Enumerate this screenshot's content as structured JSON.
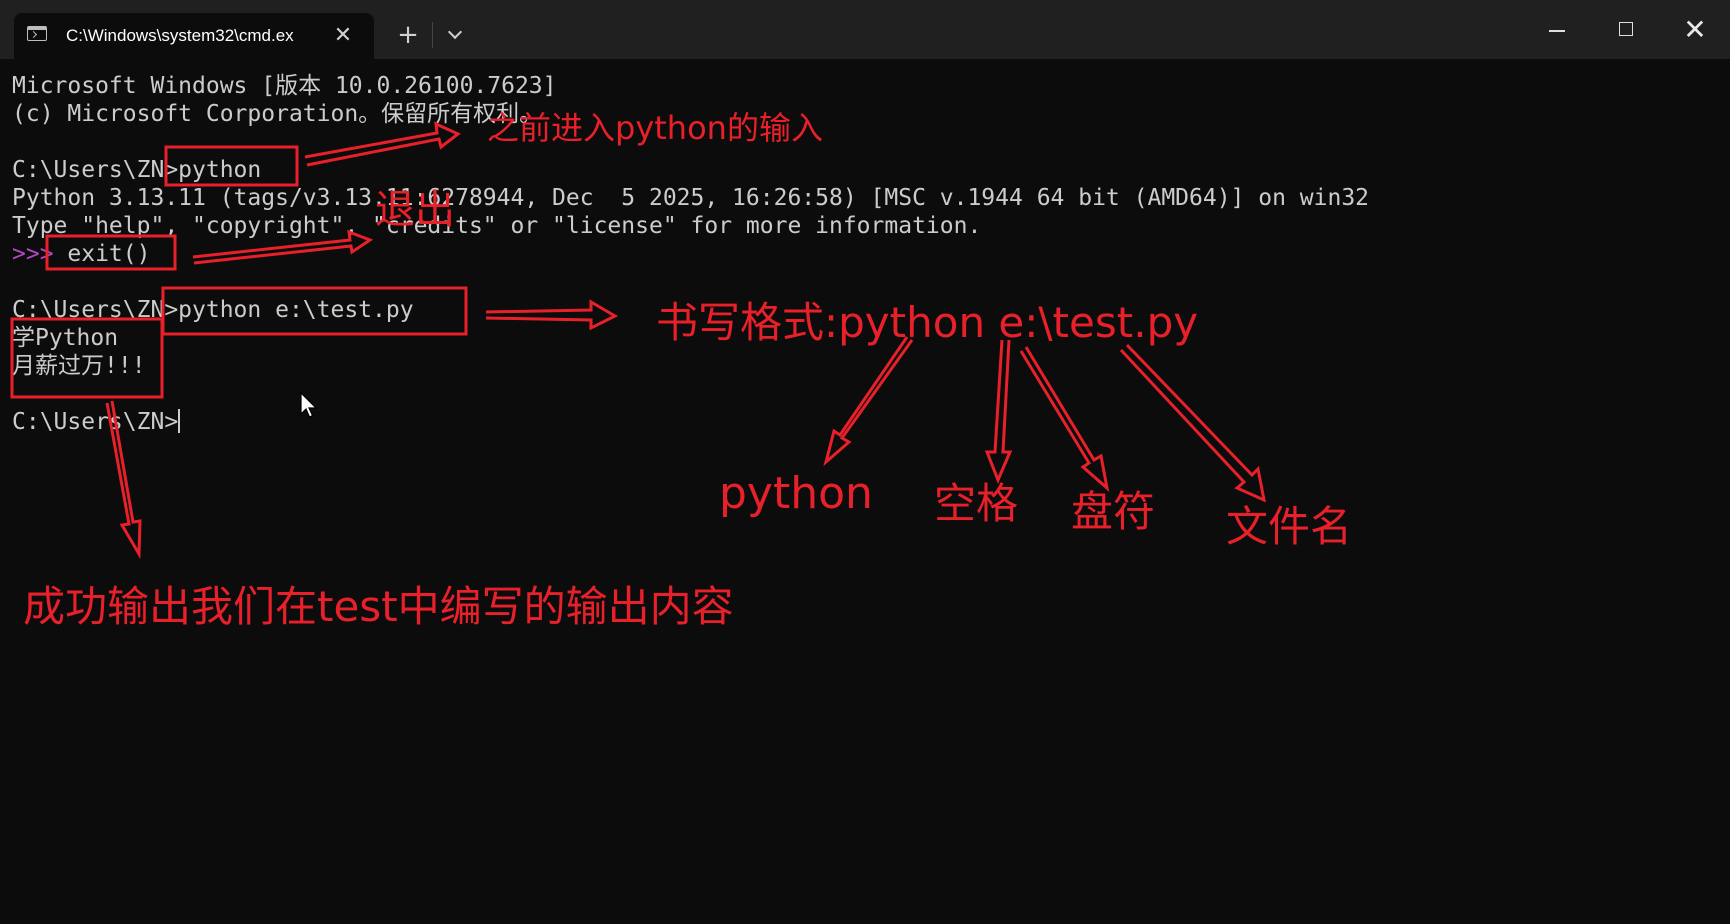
{
  "window": {
    "tab_title": "C:\\Windows\\system32\\cmd.ex",
    "tab_close_glyph": "✕",
    "new_tab_glyph": "+",
    "close_glyph": "✕"
  },
  "console": {
    "lines": [
      "Microsoft Windows [版本 10.0.26100.7623]",
      "(c) Microsoft Corporation。保留所有权利。",
      "",
      "C:\\Users\\ZN>python",
      "Python 3.13.11 (tags/v3.13.11:6278944, Dec  5 2025, 16:26:58) [MSC v.1944 64 bit (AMD64)] on win32",
      "Type \"help\", \"copyright\", \"credits\" or \"license\" for more information.",
      "",
      "",
      "C:\\Users\\ZN>python e:\\test.py",
      "学Python",
      "月薪过万!!!",
      "",
      "C:\\Users\\ZN>"
    ],
    "repl_prompt": ">>>",
    "repl_command": " exit()"
  },
  "annotations": {
    "python_enter": "之前进入python的输入",
    "exit": "退出",
    "format": "书写格式:python e:\\test.py",
    "part_python": "python",
    "part_space": "空格",
    "part_drive": "盘符",
    "part_filename": "文件名",
    "output_success": "成功输出我们在test中编写的输出内容"
  },
  "colors": {
    "annotation": "#e8202a",
    "console_bg": "#0c0c0c",
    "console_text": "#cccccc",
    "prompt_accent": "#b148c6",
    "titlebar": "#202020"
  }
}
